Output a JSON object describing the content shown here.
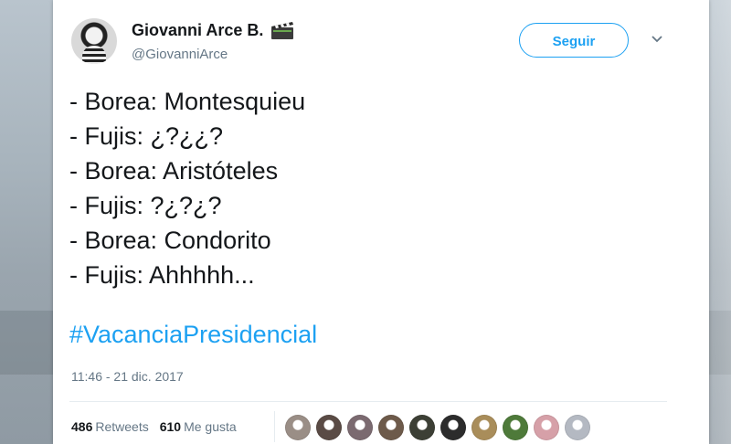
{
  "author": {
    "display_name": "Giovanni Arce B.",
    "handle": "@GiovanniArce",
    "badge_icon": "clapperboard-icon"
  },
  "follow_label": "Seguir",
  "tweet": {
    "lines": [
      "- Borea: Montesquieu",
      "- Fujis: ¿?¿¿?",
      "- Borea: Aristóteles",
      "- Fujis: ?¿?¿?",
      "- Borea: Condorito",
      "- Fujis: Ahhhhh..."
    ],
    "hashtag": "#VacanciaPresidencial",
    "timestamp": "11:46 - 21 dic. 2017"
  },
  "stats": {
    "retweets_count": "486",
    "retweets_label": "Retweets",
    "likes_count": "610",
    "likes_label": "Me gusta"
  },
  "likers": [
    {
      "color": "#9a8e86"
    },
    {
      "color": "#5a4b45"
    },
    {
      "color": "#7b6a70"
    },
    {
      "color": "#6d5a4a"
    },
    {
      "color": "#3c3f35"
    },
    {
      "color": "#2c2c2c"
    },
    {
      "color": "#a98d5a"
    },
    {
      "color": "#4e7a3a"
    },
    {
      "color": "#d6a0a8"
    },
    {
      "color": "#b4b9c2"
    }
  ],
  "colors": {
    "accent": "#1da1f2",
    "text": "#14171a",
    "muted": "#657786"
  }
}
